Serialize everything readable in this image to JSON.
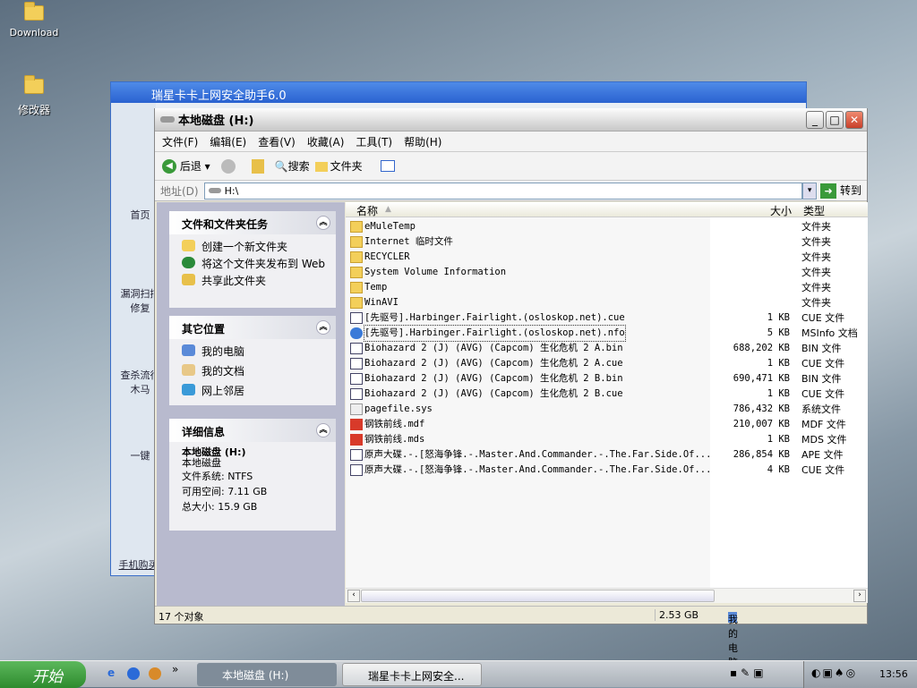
{
  "desktop": {
    "icons": [
      {
        "label": "Download"
      },
      {
        "label": "修改器"
      }
    ]
  },
  "bg_window": {
    "title": "瑞星卡卡上网安全助手6.0",
    "side": [
      "首页",
      "漏洞扫描修复",
      "查杀流行木马",
      "一键"
    ],
    "footer": "手机购买"
  },
  "explorer": {
    "title": "本地磁盘 (H:)",
    "menu": [
      "文件(F)",
      "编辑(E)",
      "查看(V)",
      "收藏(A)",
      "工具(T)",
      "帮助(H)"
    ],
    "toolbar": {
      "back": "后退",
      "search": "搜索",
      "folders": "文件夹"
    },
    "address": {
      "label": "地址(D)",
      "value": "H:\\",
      "go": "转到"
    },
    "tasks": {
      "title": "文件和文件夹任务",
      "items": [
        "创建一个新文件夹",
        "将这个文件夹发布到 Web",
        "共享此文件夹"
      ]
    },
    "places": {
      "title": "其它位置",
      "items": [
        "我的电脑",
        "我的文档",
        "网上邻居"
      ]
    },
    "details": {
      "title": "详细信息",
      "name": "本地磁盘 (H:)",
      "type": "本地磁盘",
      "fs": "文件系统: NTFS",
      "free": "可用空间: 7.11 GB",
      "total": "总大小: 15.9 GB"
    },
    "columns": {
      "name": "名称",
      "size": "大小",
      "type": "类型"
    },
    "files": [
      {
        "name": "eMuleTemp",
        "size": "",
        "type": "文件夹",
        "icon": "folder"
      },
      {
        "name": "Internet 临时文件",
        "size": "",
        "type": "文件夹",
        "icon": "folder"
      },
      {
        "name": "RECYCLER",
        "size": "",
        "type": "文件夹",
        "icon": "folder"
      },
      {
        "name": "System Volume Information",
        "size": "",
        "type": "文件夹",
        "icon": "folder"
      },
      {
        "name": "Temp",
        "size": "",
        "type": "文件夹",
        "icon": "folder"
      },
      {
        "name": "WinAVI",
        "size": "",
        "type": "文件夹",
        "icon": "folder"
      },
      {
        "name": "[先驱号].Harbinger.Fairlight.(osloskop.net).cue",
        "size": "1 KB",
        "type": "CUE 文件",
        "icon": "file"
      },
      {
        "name": "[先驱号].Harbinger.Fairlight.(osloskop.net).nfo",
        "size": "5 KB",
        "type": "MSInfo 文档",
        "icon": "info"
      },
      {
        "name": "Biohazard 2 (J) (AVG) (Capcom) 生化危机 2 A.bin",
        "size": "688,202 KB",
        "type": "BIN 文件",
        "icon": "file"
      },
      {
        "name": "Biohazard 2 (J) (AVG) (Capcom) 生化危机 2 A.cue",
        "size": "1 KB",
        "type": "CUE 文件",
        "icon": "file"
      },
      {
        "name": "Biohazard 2 (J) (AVG) (Capcom) 生化危机 2 B.bin",
        "size": "690,471 KB",
        "type": "BIN 文件",
        "icon": "file"
      },
      {
        "name": "Biohazard 2 (J) (AVG) (Capcom) 生化危机 2 B.cue",
        "size": "1 KB",
        "type": "CUE 文件",
        "icon": "file"
      },
      {
        "name": "pagefile.sys",
        "size": "786,432 KB",
        "type": "系统文件",
        "icon": "sys"
      },
      {
        "name": "钢铁前线.mdf",
        "size": "210,007 KB",
        "type": "MDF 文件",
        "icon": "mdf"
      },
      {
        "name": "钢铁前线.mds",
        "size": "1 KB",
        "type": "MDS 文件",
        "icon": "mdf"
      },
      {
        "name": "原声大碟.-.[怒海争锋.-.Master.And.Commander.-.The.Far.Side.Of...",
        "size": "286,854 KB",
        "type": "APE 文件",
        "icon": "file"
      },
      {
        "name": "原声大碟.-.[怒海争锋.-.Master.And.Commander.-.The.Far.Side.Of...",
        "size": "4 KB",
        "type": "CUE 文件",
        "icon": "file"
      }
    ],
    "status": {
      "count": "17 个对象",
      "size": "2.53 GB",
      "location": "我的电脑"
    }
  },
  "taskbar": {
    "start": "开始",
    "tasks": [
      "本地磁盘 (H:)",
      "瑞星卡卡上网安全..."
    ],
    "clock": "13:56"
  }
}
